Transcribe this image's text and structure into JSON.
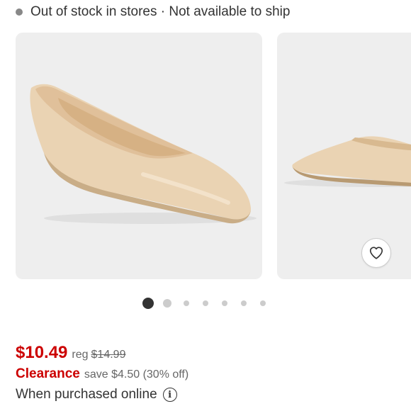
{
  "availability": {
    "text": "Out of stock in stores · Not available to ship",
    "dot_color": "#888888"
  },
  "carousel": {
    "images": [
      {
        "name": "product-image-main",
        "description_icon": "shoe-side-view"
      },
      {
        "name": "product-image-second",
        "description_icon": "shoe-toe-view"
      }
    ],
    "favorite_icon": "heart-icon",
    "page_count": 7,
    "active_index": 0
  },
  "pricing": {
    "price": "$10.49",
    "reg_label": "reg",
    "reg_price": "$14.99",
    "clearance_label": "Clearance",
    "save_text": "save $4.50 (30% off)",
    "online_text": "When purchased online",
    "accent_color": "#cc0000"
  }
}
